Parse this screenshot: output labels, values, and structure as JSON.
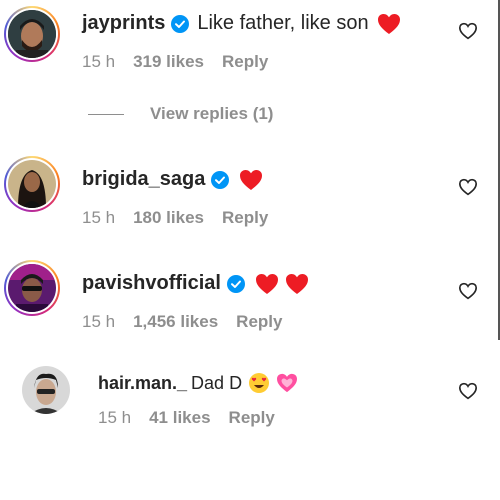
{
  "comments": [
    {
      "username": "jayprints",
      "verified": true,
      "text": "Like father, like son",
      "emoji": [
        "red-heart"
      ],
      "time": "15 h",
      "likes": "319 likes",
      "reply": "Reply"
    },
    {
      "username": "brigida_saga",
      "verified": true,
      "text": "",
      "emoji": [
        "red-heart"
      ],
      "time": "15 h",
      "likes": "180 likes",
      "reply": "Reply"
    },
    {
      "username": "pavishvofficial",
      "verified": true,
      "text": "",
      "emoji": [
        "red-heart",
        "red-heart"
      ],
      "time": "15 h",
      "likes": "1,456 likes",
      "reply": "Reply"
    }
  ],
  "view_replies": "View replies (1)",
  "reply_comment": {
    "username": "hair.man._",
    "text": "Dad D",
    "emoji": [
      "heart-eyes",
      "pink-heart"
    ],
    "time": "15 h",
    "likes": "41 likes",
    "reply": "Reply"
  },
  "colors": {
    "text": "#262626",
    "muted": "#8e8e8e",
    "verified": "#0095f6",
    "heart": "#ed4956"
  },
  "icons": {
    "like": "heart-outline-icon",
    "verified": "verified-badge-icon"
  }
}
